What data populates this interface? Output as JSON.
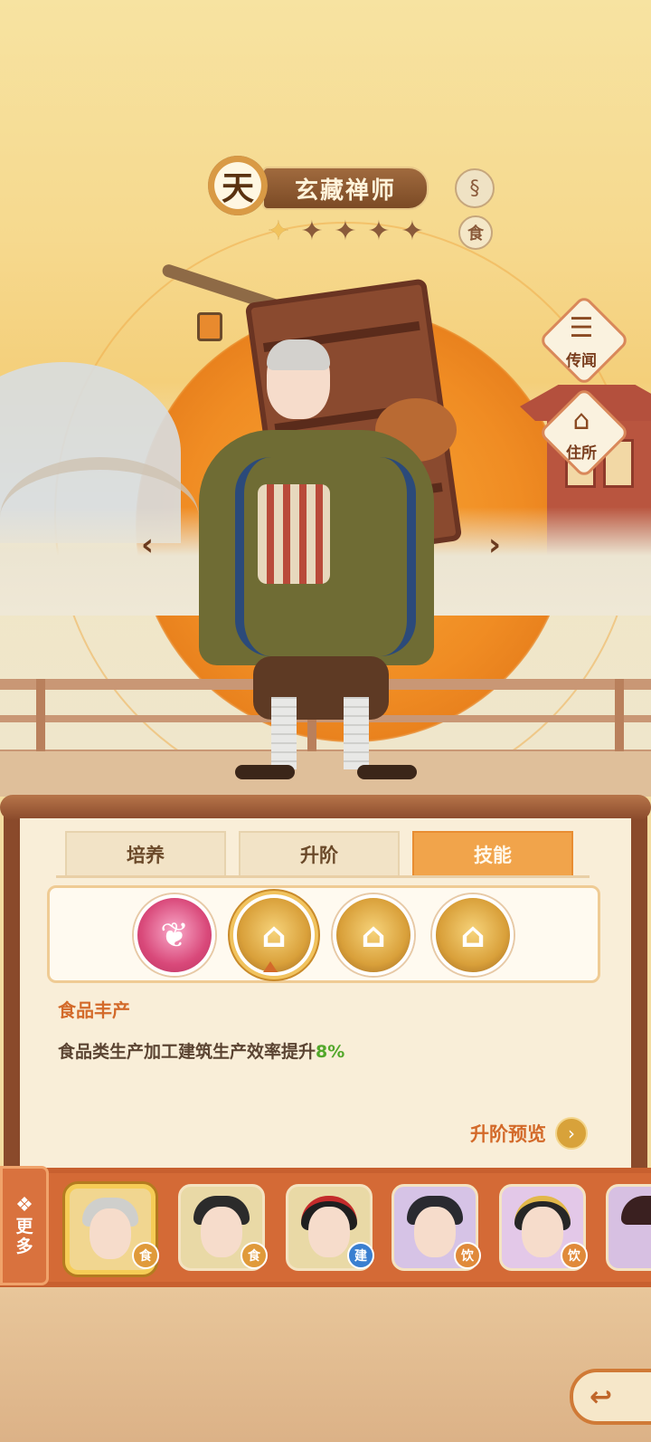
{
  "character": {
    "grade": "天",
    "name": "玄藏禅师",
    "stars_total": 5,
    "stars_lit": 1,
    "type_badge": "食",
    "element_icon": "swirl-icon"
  },
  "side_buttons": [
    {
      "label": "传闻",
      "icon": "scroll-icon"
    },
    {
      "label": "住所",
      "icon": "house-icon"
    }
  ],
  "nav": {
    "prev": "‹",
    "next": "›"
  },
  "tabs": [
    {
      "label": "培养",
      "active": false
    },
    {
      "label": "升阶",
      "active": false
    },
    {
      "label": "技能",
      "active": true
    }
  ],
  "skills": [
    {
      "name": "sprout-icon",
      "style": "pink",
      "selected": false
    },
    {
      "name": "house-up-icon",
      "style": "gold",
      "selected": true
    },
    {
      "name": "house-up-icon",
      "style": "gold",
      "selected": false
    },
    {
      "name": "house-plus-icon",
      "style": "gold",
      "selected": false
    }
  ],
  "skill_detail": {
    "name": "食品丰产",
    "description": "食品类生产加工建筑生产效率提升",
    "value": "8%"
  },
  "preview": {
    "label": "升阶预览",
    "arrow": "›"
  },
  "roster": {
    "more_label_1": "更",
    "more_label_2": "多",
    "more_icon": "❖",
    "members": [
      {
        "tag": "食",
        "tag_type": "food",
        "selected": true
      },
      {
        "tag": "食",
        "tag_type": "food",
        "selected": false
      },
      {
        "tag": "建",
        "tag_type": "build",
        "selected": false
      },
      {
        "tag": "饮",
        "tag_type": "drink",
        "selected": false
      },
      {
        "tag": "饮",
        "tag_type": "drink",
        "selected": false
      }
    ]
  },
  "colors": {
    "accent": "#d36a2a",
    "tab_active": "#f1a44b",
    "value_green": "#52a72a"
  }
}
